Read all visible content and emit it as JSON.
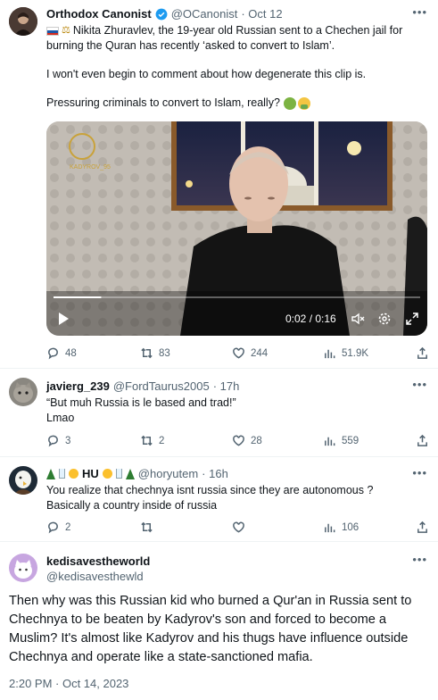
{
  "main_tweet": {
    "name": "Orthodox Canonist",
    "handle": "@OCanonist",
    "date": "· Oct 12",
    "line1": "Nikita Zhuravlev, the 19-year old Russian sent to a Chechen jail for",
    "line2": "burning the Quran has recently ‘asked to convert to Islam’.",
    "line3": "I won't even begin to comment about how degenerate this clip is.",
    "line4": "Pressuring criminals to convert to Islam, really?",
    "video": {
      "watermark": "KADYROV_95",
      "time": "0:02 / 0:16",
      "progress": 0.13
    },
    "stats": {
      "replies": "48",
      "reposts": "83",
      "likes": "244",
      "views": "51.9K"
    }
  },
  "reply1": {
    "name": "javierg_239",
    "handle": "@FordTaurus2005",
    "date": "· 17h",
    "line1": "“But muh Russia is le based and trad!”",
    "line2": "Lmao",
    "stats": {
      "replies": "3",
      "reposts": "2",
      "likes": "28",
      "views": "559"
    }
  },
  "reply2": {
    "name": "HU",
    "handle": "@horyutem",
    "date": "· 16h",
    "line1": "You realize that chechnya isnt russia since they are autonomous ?",
    "line2": "Basically a country inside of russia",
    "stats": {
      "replies": "2",
      "reposts": "",
      "likes": "",
      "views": "106"
    }
  },
  "focused": {
    "name": "kedisavestheworld",
    "handle": "@kedisavesthewld",
    "lines": [
      "Then why was this Russian kid who burned a Qur'an in Russia sent to",
      "Chechnya to be beaten by Kadyrov's son and forced to become a",
      "Muslim? It's almost like Kadyrov and his thugs have influence outside",
      "Chechnya and operate like a state-sanctioned mafia."
    ],
    "timestamp": "2:20 PM · Oct 14, 2023"
  },
  "colors": {
    "verified": "#1d9bf0",
    "text": "#0f1419",
    "muted": "#536471"
  }
}
